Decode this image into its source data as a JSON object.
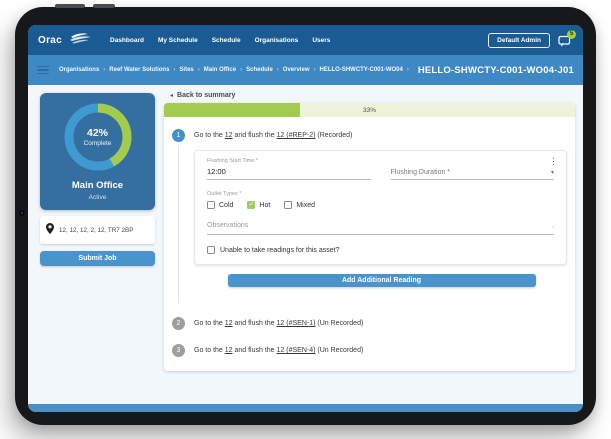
{
  "colors": {
    "header_bg": "#1a5b94",
    "breadcrumb_bg": "#3e88c4",
    "accent_blue": "#4a94cd",
    "card_blue": "#356f9f",
    "donut_green": "#a3cb4e",
    "donut_blue": "#3f9ad2",
    "progress_green": "#a2cb52",
    "progress_track": "#f1f2dc",
    "checked_green": "#9ccc65",
    "inactive_step_grey": "#9e9e9e",
    "badge_green": "#a9c838"
  },
  "header": {
    "logo": "Orac",
    "nav": [
      "Dashboard",
      "My Schedule",
      "Schedule",
      "Organisations",
      "Users"
    ],
    "admin_button": "Default Admin",
    "badge_count": "5"
  },
  "breadcrumbs": {
    "separator": "›",
    "items": [
      "Organisations",
      "Reef Water Solutions",
      "Sites",
      "Main Office",
      "Schedule",
      "Overview",
      "HELLO-SHWCTY-C001-WO04"
    ],
    "current": "HELLO-SHWCTY-C001-WO04-J01"
  },
  "sidebar": {
    "progress_value": 42,
    "progress_percent": "42%",
    "progress_caption": "Complete",
    "site_name": "Main Office",
    "site_status": "Active",
    "address": "12, 12, 12, 2, 12, TR7 2BP",
    "submit_button": "Submit Job"
  },
  "main": {
    "back_link": "Back to summary",
    "back_arrow": "◂",
    "progress": {
      "value": 33,
      "label": "33%"
    },
    "steps": [
      {
        "number": "1",
        "prefix": "Go to the ",
        "link1": "12",
        "mid": " and flush the ",
        "link2": "12 (#REP-2)",
        "suffix": " (Recorded)"
      },
      {
        "number": "2",
        "prefix": "Go to the ",
        "link1": "12",
        "mid": " and flush the ",
        "link2": "12 (#SEN-1)",
        "suffix": " (Un Recorded)"
      },
      {
        "number": "3",
        "prefix": "Go to the ",
        "link1": "12",
        "mid": " and flush the ",
        "link2": "12 (#SEN-4)",
        "suffix": " (Un Recorded)"
      }
    ],
    "form": {
      "kebab": "⋮",
      "flushing_start_time_label": "Flushing Start Time *",
      "flushing_start_time_value": "12:00",
      "flushing_duration_label": "Flushing Duration *",
      "dropdown_caret": "▾",
      "outlet_types_label": "Outlet Types *",
      "outlet_options": [
        {
          "label": "Cold",
          "checked": false
        },
        {
          "label": "Hot",
          "checked": true
        },
        {
          "label": "Mixed",
          "checked": false
        }
      ],
      "check_glyph": "✓",
      "observations_placeholder": "Observations",
      "unable_label": "Unable to take readings for this asset?",
      "unable_checked": false,
      "add_button": "Add Additional Reading"
    }
  }
}
